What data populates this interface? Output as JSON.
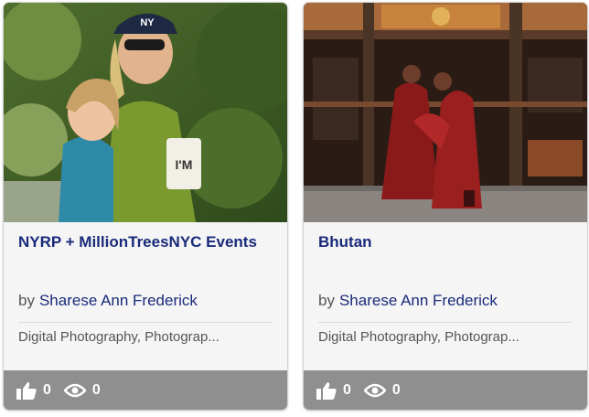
{
  "projects": [
    {
      "title": "NYRP + MillionTreesNYC Events",
      "by_label": "by",
      "author": "Sharese Ann Frederick",
      "fields": "Digital Photography, Photograp...",
      "appreciations": "0",
      "views": "0",
      "thumb_tag_text": "I'M",
      "cap_logo_text": "NY"
    },
    {
      "title": "Bhutan",
      "by_label": "by",
      "author": "Sharese Ann Frederick",
      "fields": "Digital Photography, Photograp...",
      "appreciations": "0",
      "views": "0"
    }
  ],
  "colors": {
    "title_link": "#1a2a7a",
    "stats_bar": "#8f8f8f",
    "card_bg": "#f5f5f5"
  },
  "icons": {
    "appreciate": "thumbs-up-icon",
    "views": "eye-icon"
  }
}
